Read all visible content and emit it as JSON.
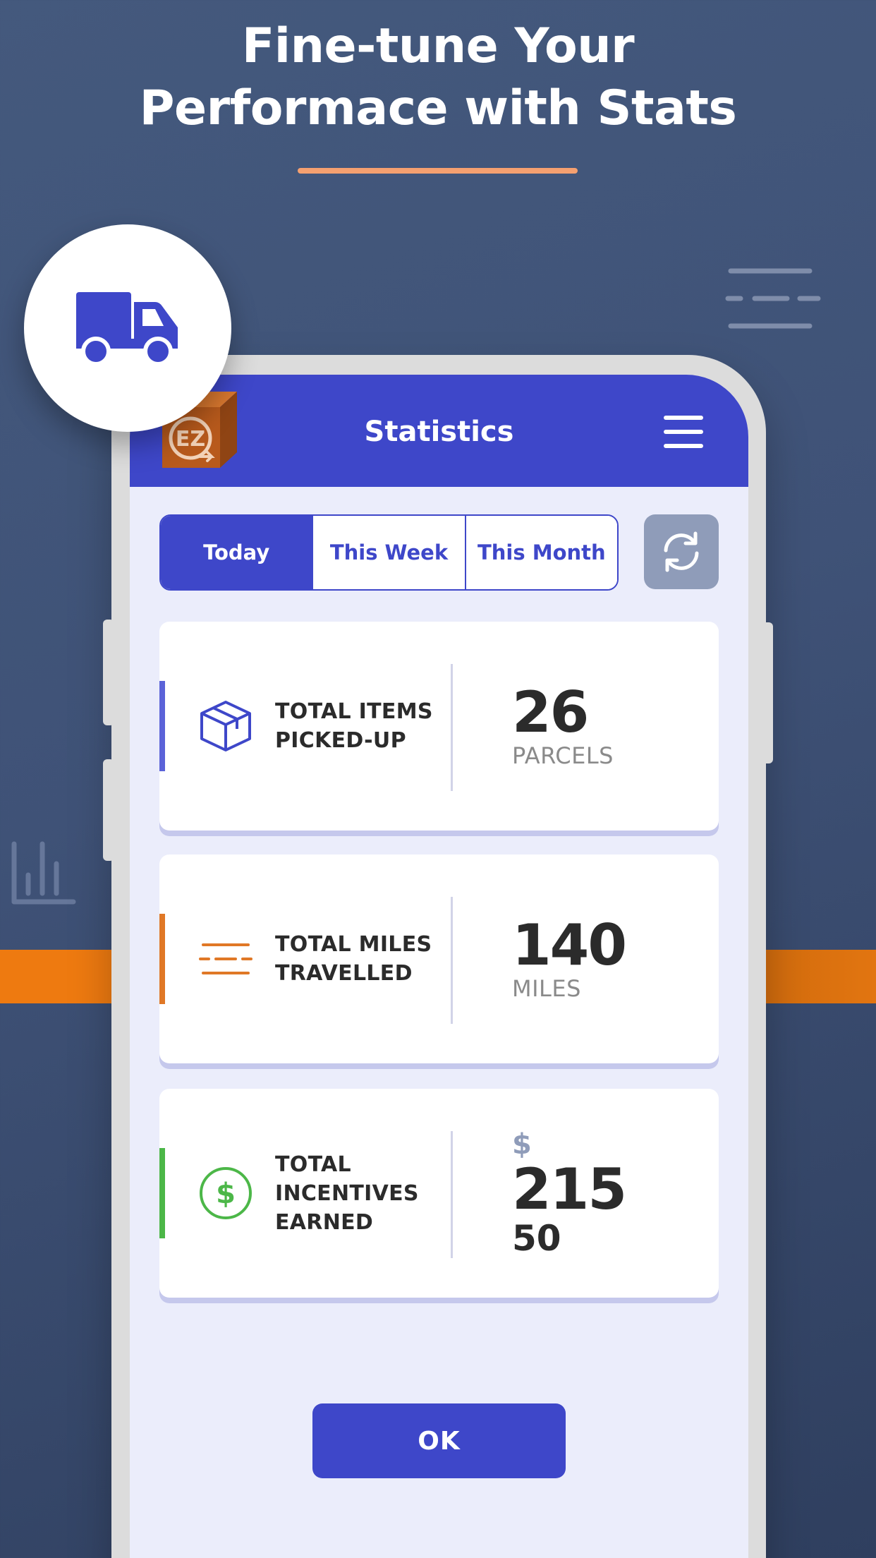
{
  "headline": {
    "line1": "Fine-tune Your",
    "line2": "Performace with Stats"
  },
  "colors": {
    "background": "#44597d",
    "accent": "#3e47c9",
    "headline_underline": "#f5a070",
    "orange_band": "#ee7a10",
    "items_accent": "#5b63d8",
    "miles_accent": "#e07826",
    "incentives_accent": "#4cb748",
    "refresh_button": "#8f9cb9"
  },
  "badge": {
    "icon": "truck-icon"
  },
  "app": {
    "title": "Statistics",
    "logo_text": "EZ",
    "menu_icon": "hamburger-menu-icon"
  },
  "tabs": [
    {
      "label": "Today",
      "active": true
    },
    {
      "label": "This Week",
      "active": false
    },
    {
      "label": "This Month",
      "active": false
    }
  ],
  "refresh": {
    "icon": "refresh-icon"
  },
  "stats": {
    "items": {
      "label_line1": "TOTAL ITEMS",
      "label_line2": "PICKED-UP",
      "value": "26",
      "unit": "PARCELS",
      "icon": "package-box-icon"
    },
    "miles": {
      "label_line1": "TOTAL MILES",
      "label_line2": "TRAVELLED",
      "value": "140",
      "unit": "MILES",
      "icon": "road-lines-icon"
    },
    "incentives": {
      "label_line1": "TOTAL",
      "label_line2": "INCENTIVES",
      "label_line3": "EARNED",
      "currency": "$",
      "value": "215",
      "cents": "50",
      "icon": "dollar-circle-icon"
    }
  },
  "ok_button": {
    "label": "OK"
  }
}
